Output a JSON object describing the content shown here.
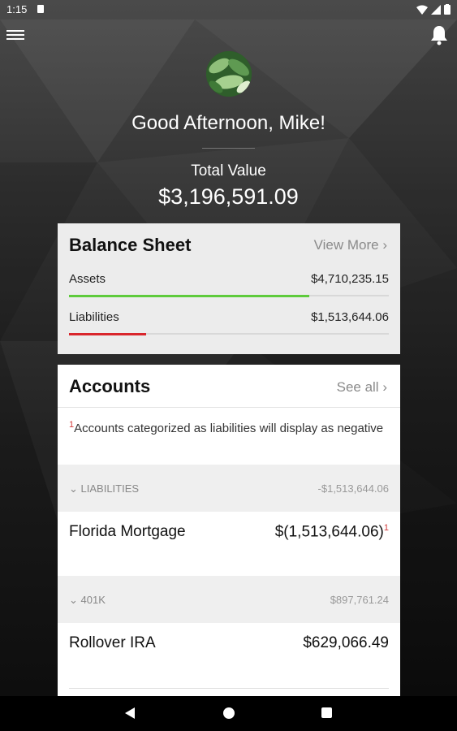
{
  "status_bar": {
    "time": "1:15"
  },
  "header": {
    "greeting": "Good Afternoon, Mike!",
    "total_label": "Total Value",
    "total_value": "$3,196,591.09"
  },
  "balance_sheet": {
    "title": "Balance Sheet",
    "link": "View More",
    "assets": {
      "label": "Assets",
      "value": "$4,710,235.15",
      "bar_fraction": 0.75,
      "bar_color": "#5ecb3c"
    },
    "liabilities": {
      "label": "Liabilities",
      "value": "$1,513,644.06",
      "bar_fraction": 0.24,
      "bar_color": "#d9262c"
    }
  },
  "accounts": {
    "title": "Accounts",
    "link": "See all",
    "note_marker": "1",
    "note": "Accounts categorized as liabilities will display as negative",
    "groups": [
      {
        "label": "LIABILITIES",
        "total": "-$1,513,644.06",
        "accounts": [
          {
            "name": "Florida Mortgage",
            "value": "$(1,513,644.06)",
            "marker": "1"
          }
        ]
      },
      {
        "label": "401K",
        "total": "$897,761.24",
        "accounts": [
          {
            "name": "Rollover IRA",
            "value": "$629,066.49",
            "marker": ""
          }
        ]
      }
    ]
  },
  "icons": {
    "menu": "hamburger-menu-icon",
    "notifications": "bell-icon",
    "nav_back": "back-triangle-icon",
    "nav_home": "home-circle-icon",
    "nav_recent": "recent-apps-square-icon"
  },
  "colors": {
    "asset_bar": "#5ecb3c",
    "liability_bar": "#d9262c",
    "marker": "#d23b3b"
  }
}
